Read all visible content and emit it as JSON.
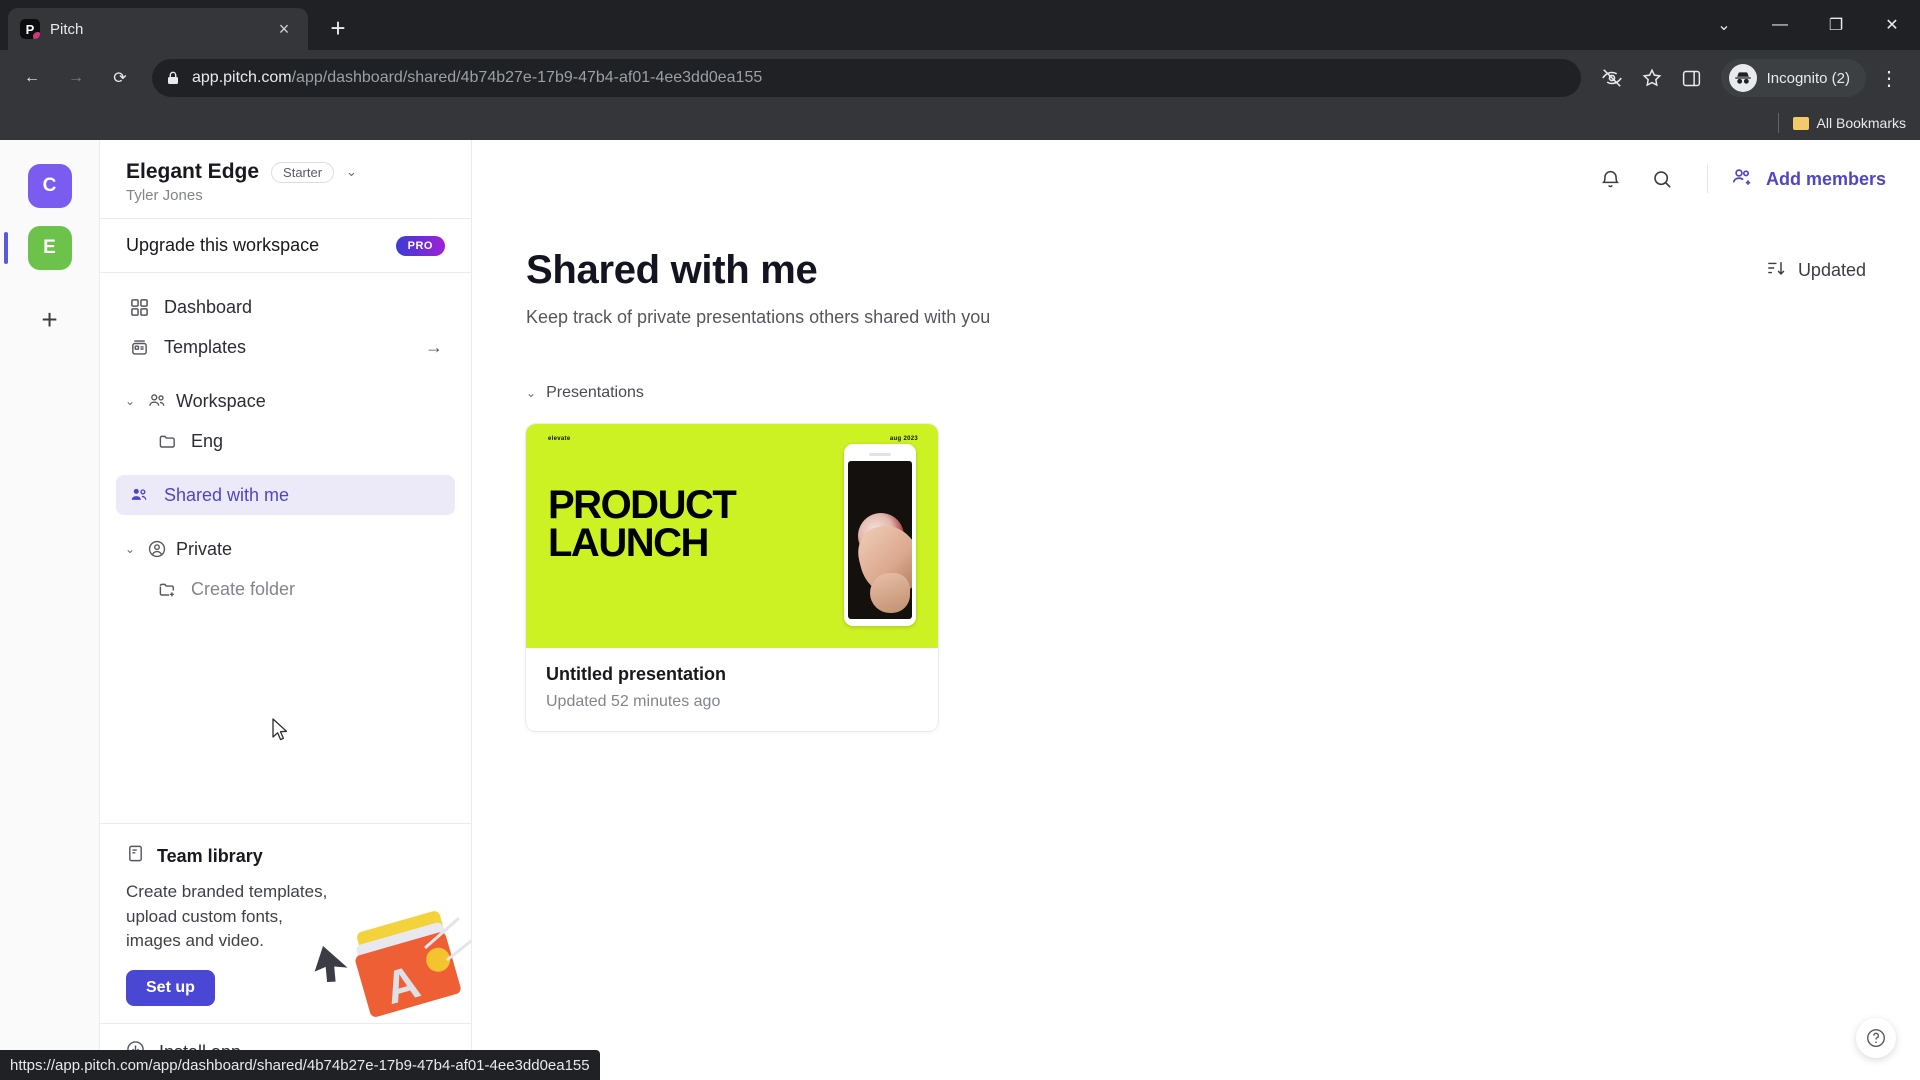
{
  "browser": {
    "tab": {
      "title": "Pitch",
      "favicon_letter": "P",
      "close_label": "×"
    },
    "new_tab_label": "+",
    "window": {
      "minimize": "—",
      "maximize": "❐",
      "close": "✕",
      "tab_search": "⌄"
    },
    "nav": {
      "back": "←",
      "forward": "→",
      "reload": "⟳"
    },
    "omnibox": {
      "domain": "app.pitch.com",
      "path": "/app/dashboard/shared/4b74b27e-17b9-47b4-af01-4ee3dd0ea155",
      "lock_icon": "lock-icon"
    },
    "toolbar_icons": [
      "third-party-cookie-blocked-icon",
      "bookmark-star-icon",
      "side-panel-icon"
    ],
    "profile": {
      "label": "Incognito (2)"
    },
    "menu_label": "⋮",
    "bookmarks": {
      "all_bookmarks_label": "All Bookmarks"
    },
    "status_bar": {
      "url": "https://app.pitch.com/app/dashboard/shared/4b74b27e-17b9-47b4-af01-4ee3dd0ea155"
    }
  },
  "rail": {
    "workspaces": [
      {
        "letter": "C",
        "color": "#7a5cf0",
        "active": false
      },
      {
        "letter": "E",
        "color": "#6dc24b",
        "active": true
      }
    ],
    "add_label": "+"
  },
  "sidebar": {
    "workspace_name": "Elegant Edge",
    "plan_badge": "Starter",
    "owner": "Tyler Jones",
    "chevron": "⌄",
    "upgrade": {
      "label": "Upgrade this workspace",
      "badge": "PRO"
    },
    "items": [
      {
        "label": "Dashboard",
        "icon": "grid-icon"
      },
      {
        "label": "Templates",
        "icon": "templates-icon",
        "tail": "→"
      }
    ],
    "workspace_group": {
      "label": "Workspace",
      "icon": "people-icon",
      "caret": "⌄"
    },
    "workspace_children": [
      {
        "label": "Eng",
        "icon": "folder-icon"
      }
    ],
    "shared_with_me": {
      "label": "Shared with me",
      "icon": "shared-people-icon",
      "active": true
    },
    "private_group": {
      "label": "Private",
      "icon": "person-circle-icon",
      "caret": "⌄"
    },
    "private_children": [
      {
        "label": "Create folder",
        "icon": "folder-plus-icon"
      }
    ],
    "promo": {
      "title": "Team library",
      "icon": "library-icon",
      "text": "Create branded templates, upload custom fonts, images and video.",
      "button": "Set up"
    },
    "install": {
      "label": "Install app",
      "icon": "download-icon"
    }
  },
  "topbar": {
    "notifications_icon": "bell-icon",
    "search_icon": "search-icon",
    "add_members": {
      "label": "Add members",
      "icon": "add-members-icon"
    }
  },
  "main": {
    "title": "Shared with me",
    "subtitle": "Keep track of private presentations others shared with you",
    "sort": {
      "label": "Updated",
      "icon": "sort-descending-icon"
    },
    "section": {
      "label": "Presentations",
      "caret": "⌄"
    },
    "cards": [
      {
        "thumb_line1": "PRODUCT",
        "thumb_line2": "LAUNCH",
        "thumb_tiny_left": "elevate",
        "thumb_tiny_right": "aug 2023",
        "thumb_color": "#ccf223",
        "title": "Untitled presentation",
        "meta": "Updated 52 minutes ago"
      }
    ],
    "help_label": "?"
  }
}
